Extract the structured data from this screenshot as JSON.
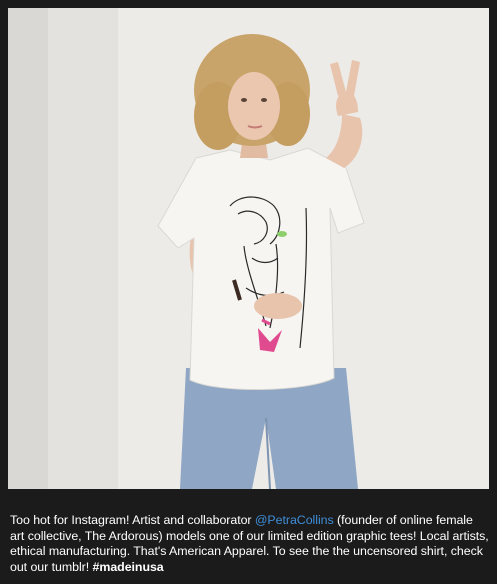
{
  "post": {
    "caption_start": "Too hot for Instagram! Artist and collaborator ",
    "mention": "@PetraCollins",
    "caption_end": " (founder of online female art collective, The Ardorous) models one of our limited edition graphic tees! Local artists, ethical manufacturing. That's American Apparel. To see the the uncensored shirt, check out our tumblr! ",
    "hashtag": "#madeinusa"
  },
  "photo": {
    "subject": "woman-in-graphic-tee-peace-sign",
    "colors": {
      "wall": "#ecebe8",
      "hair": "#c9a46a",
      "skin": "#e8c4ad",
      "shirt": "#f6f5f2",
      "jeans": "#8fa6c4",
      "accent_pink": "#e04a8e"
    }
  },
  "colors": {
    "background": "#1b1b1b",
    "text": "#ffffff",
    "mention": "#3f8ed8"
  }
}
